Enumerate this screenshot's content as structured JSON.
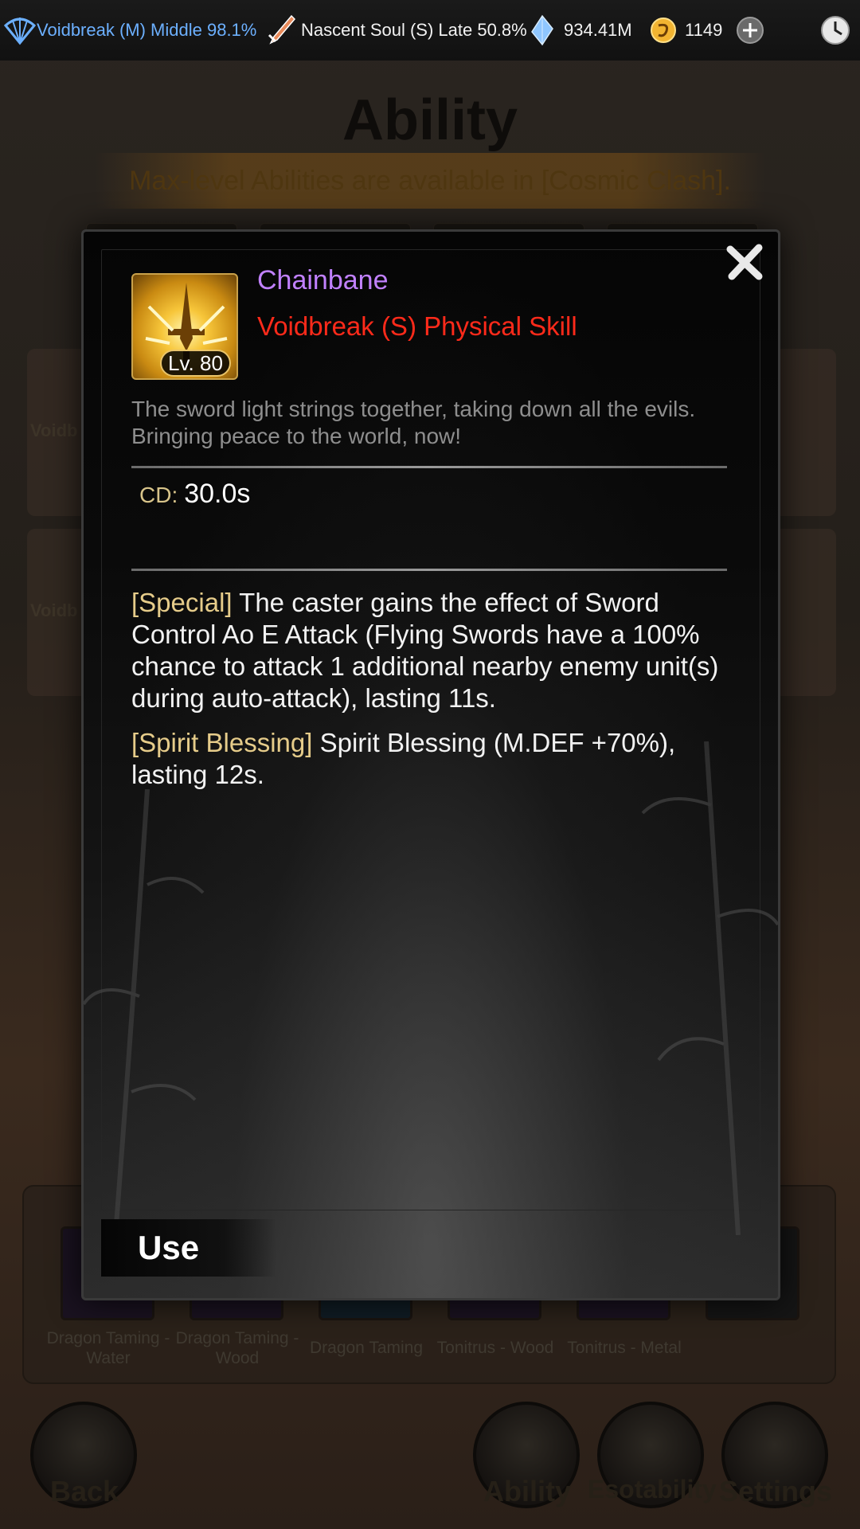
{
  "status_bar": {
    "rank1": "Voidbreak (M) Middle 98.1%",
    "rank2": "Nascent Soul (S) Late 50.8%",
    "crystals": "934.41M",
    "currency": "1149",
    "icons": [
      "fan-icon",
      "sword-icon",
      "crystal-icon",
      "coin-icon",
      "plus-icon",
      "clock-icon"
    ]
  },
  "background": {
    "title": "Ability",
    "notice": "Max-level Abilities are available in [Cosmic Clash].",
    "card_label": "Voidb",
    "slots": [
      "Dragon Taming - Water",
      "Dragon Taming - Wood",
      "Dragon Taming",
      "Tonitrus - Wood",
      "Tonitrus - Metal"
    ],
    "nav": {
      "back": "Back",
      "ability": "Ability",
      "esotability": "Esotability",
      "settings": "Settings"
    }
  },
  "skill": {
    "name": "Chainbane",
    "type": "Voidbreak (S) Physical Skill",
    "level": "Lv. 80",
    "description": "The sword light strings together, taking down all the evils. Bringing peace to the world, now!",
    "cd_label": "CD:",
    "cd_value": "30.0s",
    "effects": [
      {
        "tag": "[Special]",
        "text": "The caster gains the effect of Sword Control Ao E Attack (Flying Swords have a 100% chance to attack 1 additional nearby enemy unit(s) during auto-attack), lasting 11s."
      },
      {
        "tag": "[Spirit Blessing]",
        "text": "Spirit Blessing (M.DEF +70%), lasting 12s."
      }
    ]
  },
  "actions": {
    "use": "Use"
  },
  "colors": {
    "skill_name": "#c181ff",
    "skill_type": "#ff2a1a",
    "tag": "#e6cc8a",
    "rank1": "#6cb0ff"
  }
}
